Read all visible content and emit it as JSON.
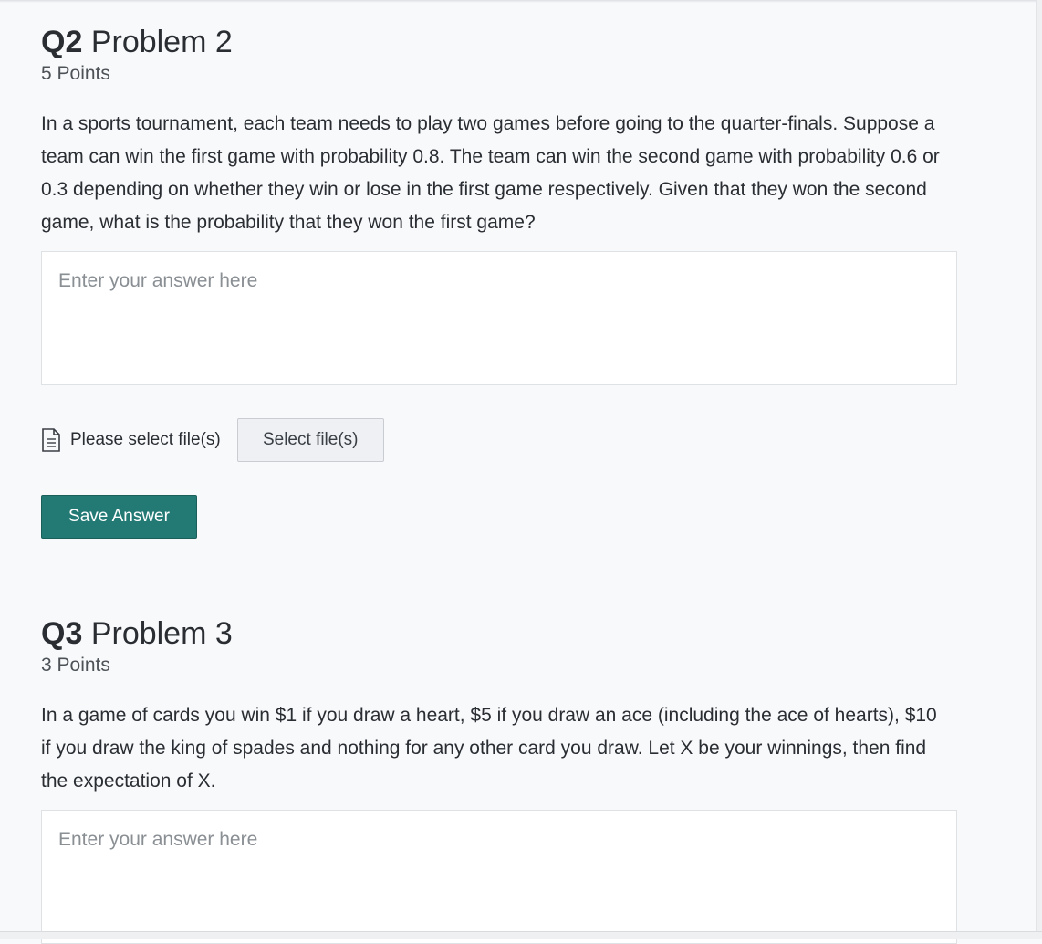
{
  "questions": [
    {
      "number": "Q2",
      "title": "Problem 2",
      "points": "5 Points",
      "text": "In a sports tournament, each team needs to play two games before going to the quarter-finals. Suppose a team can win the first game with probability 0.8. The team can win the second game with probability 0.6 or 0.3 depending on whether they win or lose in the first game respectively. Given that they won the second game, what is the probability that they won the first game?",
      "answer_placeholder": "Enter your answer here",
      "answer_value": "",
      "file_label": "Please select file(s)",
      "file_button": "Select file(s)",
      "file_icon": "document-icon",
      "save_button": "Save Answer"
    },
    {
      "number": "Q3",
      "title": "Problem 3",
      "points": "3 Points",
      "text": "In a game of cards you win $1 if you draw a heart, $5 if you draw an ace (including the ace of hearts), $10 if you draw the king of spades and nothing for any other card you draw. Let X be your winnings, then find the expectation of X.",
      "answer_placeholder": "Enter your answer here",
      "answer_value": ""
    }
  ],
  "colors": {
    "background": "#f8f9fb",
    "text": "#2a2e33",
    "save_button": "#237a75",
    "select_button": "#eef0f3"
  }
}
